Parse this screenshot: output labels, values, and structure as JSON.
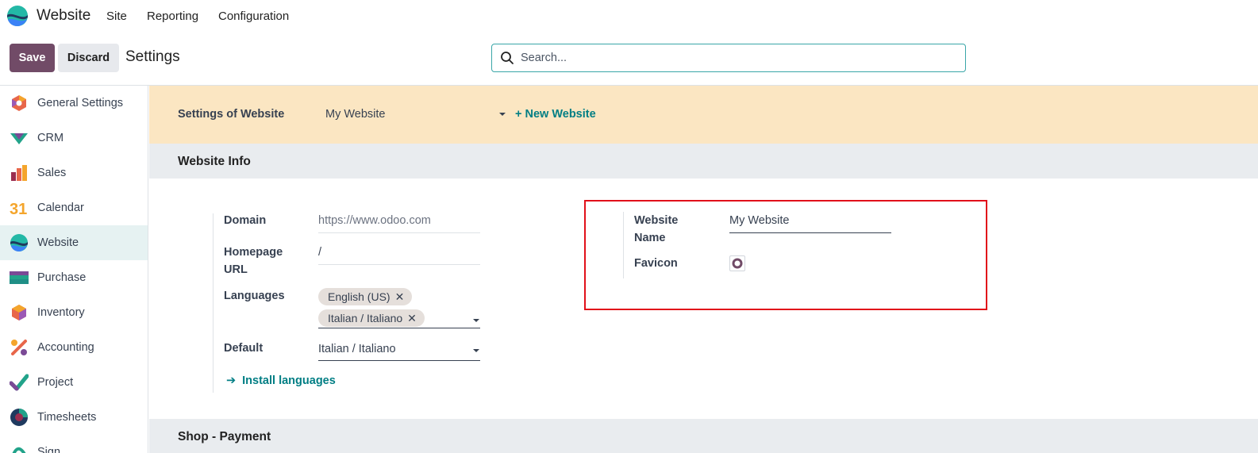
{
  "navbar": {
    "app_name": "Website",
    "menu": [
      "Site",
      "Reporting",
      "Configuration"
    ]
  },
  "control_panel": {
    "save_label": "Save",
    "discard_label": "Discard",
    "title": "Settings",
    "search_placeholder": "Search..."
  },
  "sidebar": {
    "items": [
      {
        "label": "General Settings",
        "icon": "general-settings-icon"
      },
      {
        "label": "CRM",
        "icon": "crm-icon"
      },
      {
        "label": "Sales",
        "icon": "sales-icon"
      },
      {
        "label": "Calendar",
        "icon": "calendar-icon",
        "icon_text": "31"
      },
      {
        "label": "Website",
        "icon": "website-icon",
        "active": true
      },
      {
        "label": "Purchase",
        "icon": "purchase-icon"
      },
      {
        "label": "Inventory",
        "icon": "inventory-icon"
      },
      {
        "label": "Accounting",
        "icon": "accounting-icon"
      },
      {
        "label": "Project",
        "icon": "project-icon"
      },
      {
        "label": "Timesheets",
        "icon": "timesheets-icon"
      },
      {
        "label": "Sign",
        "icon": "sign-icon"
      }
    ]
  },
  "website_bar": {
    "label": "Settings of Website",
    "selected": "My Website",
    "new_label": "+ New Website"
  },
  "sections": {
    "website_info": "Website Info",
    "shop_payment": "Shop - Payment"
  },
  "website_info": {
    "domain_label": "Domain",
    "domain_placeholder": "https://www.odoo.com",
    "homepage_label": "Homepage URL",
    "homepage_value": "/",
    "languages_label": "Languages",
    "languages": [
      "English (US)",
      "Italian / Italiano"
    ],
    "default_label": "Default",
    "default_value": "Italian / Italiano",
    "install_label": "Install languages",
    "website_name_label": "Website Name",
    "website_name_value": "My Website",
    "favicon_label": "Favicon"
  },
  "colors": {
    "brand": "#714b67",
    "accent": "#017e84",
    "highlight": "#e1101a",
    "website_bar": "#fbe6c2"
  }
}
